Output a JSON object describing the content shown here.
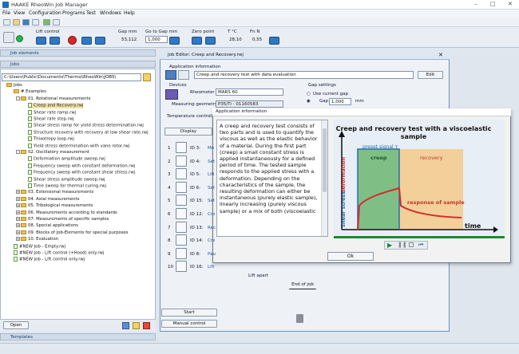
{
  "app": {
    "title": "HAAKE RheoWin Job Manager"
  },
  "menu": [
    "File",
    "View",
    "Configuration",
    "Programs",
    "Test",
    "Windows",
    "Help"
  ],
  "toolbar": {
    "lift_label": "Lift control",
    "gap_label": "Gap mm",
    "gap_value": "53,112",
    "goto_label": "Go to Gap mm",
    "goto_value": "1,000",
    "zero_label": "Zero point",
    "temp_label": "T °C",
    "temp_value": "28,10",
    "fn_label": "Fn N",
    "fn_value": "0,55"
  },
  "left": {
    "job_elements": "Job elements",
    "jobs": "Jobs",
    "path": "C:\\Users\\Public\\Documents\\Thermo\\RheoWin\\JOBS\\",
    "tree": [
      {
        "d": 0,
        "t": "f",
        "x": "",
        "l": "Jobs"
      },
      {
        "d": 1,
        "t": "f",
        "x": "",
        "l": "# Examples"
      },
      {
        "d": 2,
        "t": "f",
        "x": "-",
        "l": "01. Rotational measurements"
      },
      {
        "d": 3,
        "t": "d",
        "x": "",
        "l": "Creep and Recovery.rwj",
        "sel": true
      },
      {
        "d": 3,
        "t": "d",
        "x": "",
        "l": "Shear rate ramp.rwj"
      },
      {
        "d": 3,
        "t": "d",
        "x": "",
        "l": "Shear rate step.rwj"
      },
      {
        "d": 3,
        "t": "d",
        "x": "",
        "l": "Shear stress ramp for yield stress determination.rwj"
      },
      {
        "d": 3,
        "t": "d",
        "x": "",
        "l": "Structure recovery with recovery at low shear rate.rwj"
      },
      {
        "d": 3,
        "t": "d",
        "x": "",
        "l": "Thixotropy loop.rwj"
      },
      {
        "d": 3,
        "t": "d",
        "x": "",
        "l": "Yield stress determination with vane rotor.rwj"
      },
      {
        "d": 2,
        "t": "f",
        "x": "-",
        "l": "02. Oscillatory measurement"
      },
      {
        "d": 3,
        "t": "d",
        "x": "",
        "l": "Deformation amplitude sweep.rwj"
      },
      {
        "d": 3,
        "t": "d",
        "x": "",
        "l": "Frequency sweep with constant deformation.rwj"
      },
      {
        "d": 3,
        "t": "d",
        "x": "",
        "l": "Frequency sweep with constant shear stress.rwj"
      },
      {
        "d": 3,
        "t": "d",
        "x": "",
        "l": "Shear stress amplitude sweep.rwj"
      },
      {
        "d": 3,
        "t": "d",
        "x": "",
        "l": "Time sweep for thermal curing.rwj"
      },
      {
        "d": 2,
        "t": "f",
        "x": "+",
        "l": "03. Extensional measurements"
      },
      {
        "d": 2,
        "t": "f",
        "x": "+",
        "l": "04. Axial measurements"
      },
      {
        "d": 2,
        "t": "f",
        "x": "+",
        "l": "05. Tribological measurements"
      },
      {
        "d": 2,
        "t": "f",
        "x": "+",
        "l": "06. Measurements according to standards"
      },
      {
        "d": 2,
        "t": "f",
        "x": "+",
        "l": "07. Measurements of specific samples"
      },
      {
        "d": 2,
        "t": "f",
        "x": "+",
        "l": "08. Special applications"
      },
      {
        "d": 2,
        "t": "f",
        "x": "+",
        "l": "09. Blocks of Job-Elements for special purposes"
      },
      {
        "d": 2,
        "t": "f",
        "x": "+",
        "l": "10. Evaluation"
      },
      {
        "d": 1,
        "t": "d",
        "x": "",
        "l": "#NEW Job - Empty.rwj"
      },
      {
        "d": 1,
        "t": "d",
        "x": "",
        "l": "#NEW Job - Lift control (+Hood) only.rwj"
      },
      {
        "d": 1,
        "t": "d",
        "x": "",
        "l": "#NEW Job - Lift control only.rwj"
      }
    ],
    "open": "Open",
    "templates": "Templates"
  },
  "editor": {
    "title": "Job Editor: Creep and Recovery.rwj",
    "app_info": "Application information",
    "app_info_value": "Creep and recovery test with data evaluation",
    "edit": "Edit",
    "devices": "Devices",
    "rheometer_label": "Rheometer",
    "rheometer": "MARS 60",
    "geometry_label": "Measuring geometry",
    "geometry": "P35/Ti - 01160583",
    "gap_settings": "Gap settings",
    "use_current": "Use current gap",
    "gap_label": "Gap",
    "gap_value": "1,000",
    "gap_unit": "mm",
    "temp_ctrl": "Temperature controller",
    "display": "Display",
    "rows": [
      {
        "n": "1",
        "id": "ID 3:",
        "nm": "Me"
      },
      {
        "n": "2",
        "id": "ID 4:",
        "nm": "Set"
      },
      {
        "n": "3",
        "id": "ID 5:",
        "nm": "Lift"
      },
      {
        "n": "4",
        "id": "ID 6:",
        "nm": "Set"
      },
      {
        "n": "5",
        "id": "ID 15:",
        "nm": "Set"
      },
      {
        "n": "6",
        "id": "ID 12:",
        "nm": "Cre"
      },
      {
        "n": "7",
        "id": "ID 13:",
        "nm": "Rec"
      },
      {
        "n": "8",
        "id": "ID 14:",
        "nm": "Cre"
      },
      {
        "n": "9",
        "id": "ID 8:",
        "nm": "Pau"
      },
      {
        "n": "10",
        "id": "ID 16:",
        "nm": "Lift"
      }
    ],
    "lift_apart": "Lift apart",
    "end": "End of job",
    "start": "Start",
    "manual": "Manual control"
  },
  "dialog": {
    "title": "Application information",
    "text": "A creep and recovery test consists of two parts and is used to quantify the viscous as well as the elastic behavior of a material. During the first part (creep) a small constant stress is applied instantaneously for a defined period of time. The tested sample responds to the applied stress with a deformation. Depending on the characteristics of the sample, the resulting deformation can either be instantaneous (purely elastic sample), linearly increasing  (purely viscous sample) or a mix of both (viscoelastic",
    "fig_title": "Creep and recovery test with a viscoelastic sample",
    "preset": "preset signal τ",
    "creep": "creep",
    "recovery": "recovery",
    "response": "response of sample",
    "deformation": "deformation",
    "shear_stress": "shear stress",
    "time": "time",
    "ok": "Ok"
  },
  "colors": {
    "red": "#d52b2b",
    "blue": "#2b6cb0",
    "green": "#7fbf86",
    "orange": "#f2b87a",
    "dark_green": "#1a8a2e"
  }
}
